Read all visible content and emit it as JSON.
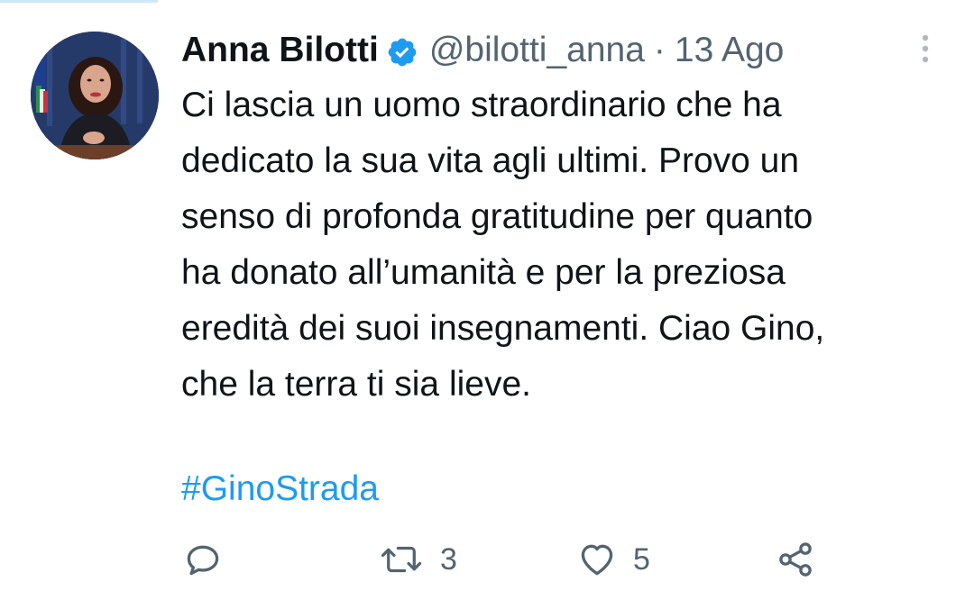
{
  "tweet": {
    "author_name": "Anna Bilotti",
    "handle": "@bilotti_anna",
    "separator": "·",
    "date": "13 Ago",
    "text_lines": [
      "Ci lascia un uomo straordinario che ha",
      "dedicato la sua vita agli ultimi. Provo un",
      "senso di profonda gratitudine per quanto",
      "ha donato all’umanità e per la preziosa",
      "eredità dei suoi insegnamenti. Ciao Gino,",
      "che la terra ti sia lieve."
    ],
    "hashtag": "#GinoStrada",
    "verified": true
  },
  "actions": {
    "reply": {
      "icon": "reply-icon",
      "count": ""
    },
    "retweet": {
      "icon": "retweet-icon",
      "count": "3"
    },
    "like": {
      "icon": "heart-icon",
      "count": "5"
    },
    "share": {
      "icon": "share-icon"
    }
  },
  "colors": {
    "text": "#0f1419",
    "secondary": "#536471",
    "link": "#1d9bf0",
    "verified": "#1d9bf0"
  }
}
